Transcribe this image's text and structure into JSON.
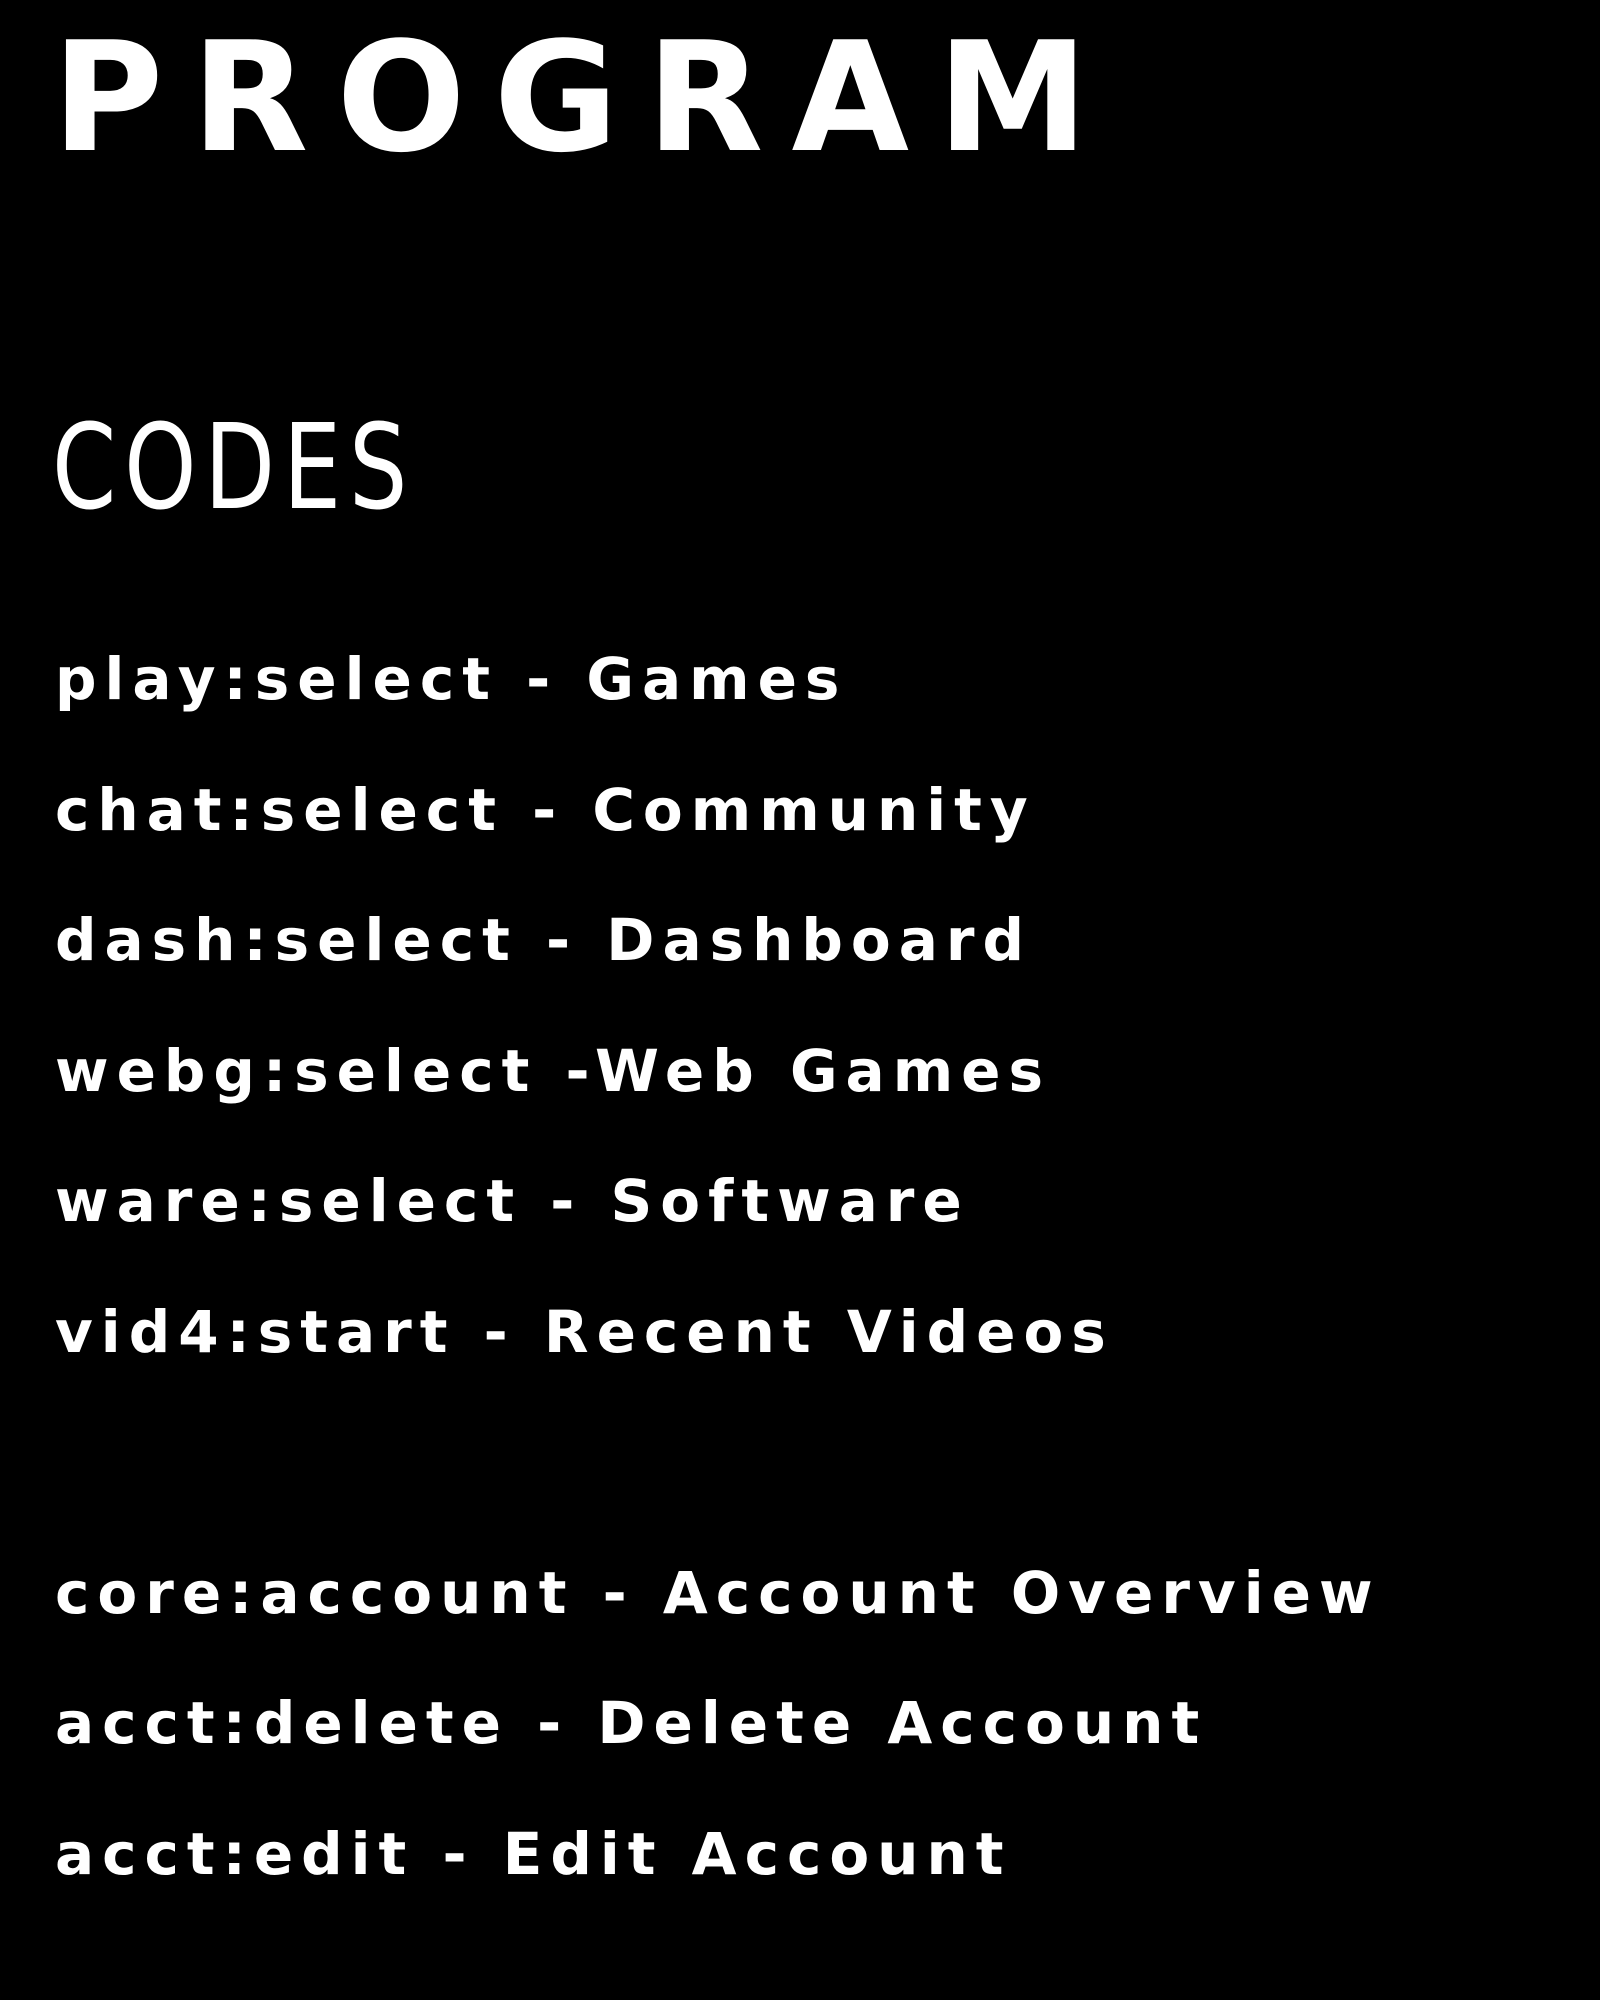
{
  "heading": {
    "title": "PROGRAM",
    "subtitle": "CODES"
  },
  "codes_group_1": [
    "play:select - Games",
    "chat:select - Community",
    "dash:select - Dashboard",
    "webg:select -Web Games",
    "ware:select - Software",
    "vid4:start - Recent Videos"
  ],
  "codes_group_2": [
    "core:account - Account Overview",
    "acct:delete - Delete Account",
    "acct:edit - Edit Account"
  ],
  "colors": {
    "background": "#000000",
    "text": "#ffffff"
  }
}
